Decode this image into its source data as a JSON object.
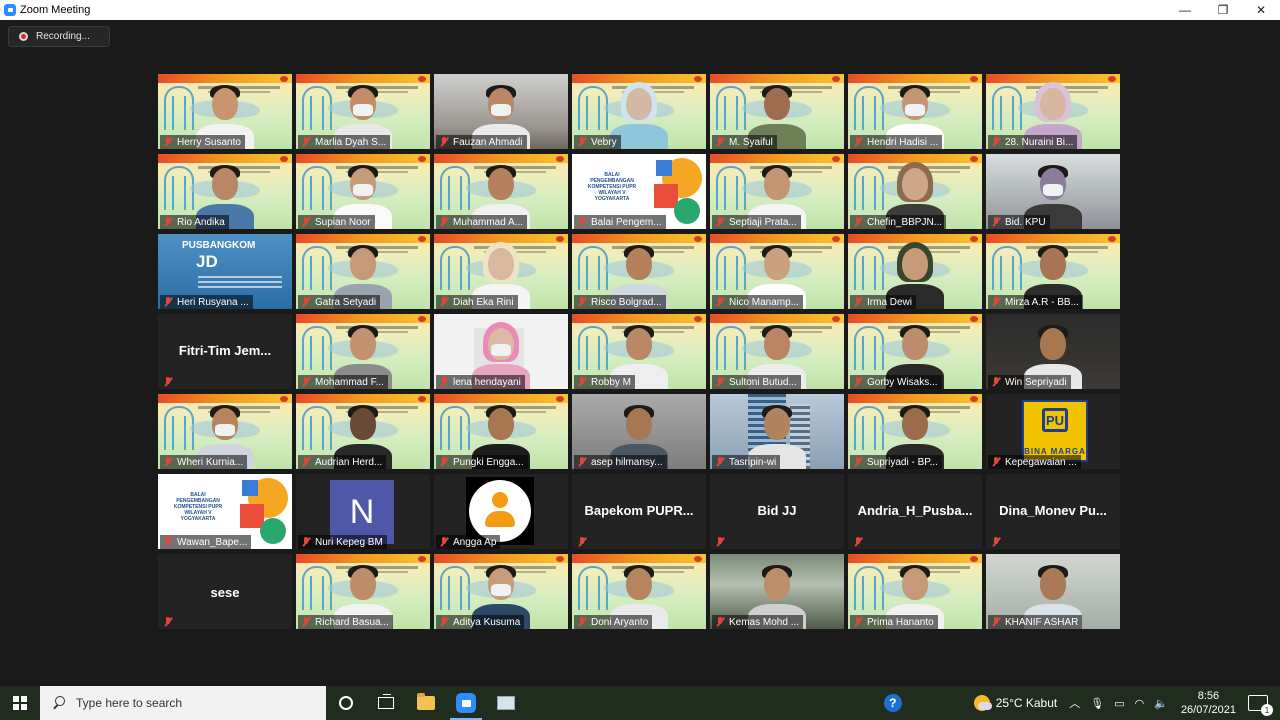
{
  "window": {
    "title": "Zoom Meeting",
    "minimize": "—",
    "restore": "❐",
    "close": "✕"
  },
  "recording": {
    "label": "Recording..."
  },
  "participants": [
    {
      "name": "Herry Susanto"
    },
    {
      "name": "Marlia Dyah S..."
    },
    {
      "name": "Fauzan Ahmadi"
    },
    {
      "name": "Vebry"
    },
    {
      "name": "M. Syaiful"
    },
    {
      "name": "Hendri Hadisi ..."
    },
    {
      "name": "28. Nuraini Bi..."
    },
    {
      "name": "Rio Andika"
    },
    {
      "name": "Supian Noor"
    },
    {
      "name": "Muhammad A..."
    },
    {
      "name": "Balai Pengem..."
    },
    {
      "name": "Septiaji Prata..."
    },
    {
      "name": "Chefin_BBPJN..."
    },
    {
      "name": "Bid. KPU"
    },
    {
      "name": "Heri Rusyana ..."
    },
    {
      "name": "Gatra Setyadi"
    },
    {
      "name": "Diah Eka Rini"
    },
    {
      "name": "Risco Bolgrad..."
    },
    {
      "name": "Nico Manamp..."
    },
    {
      "name": "Irma Dewi"
    },
    {
      "name": "Mirza A.R - BB..."
    },
    {
      "name": "Fitri-Tim Jem..."
    },
    {
      "name": "Mohammad F..."
    },
    {
      "name": "lena hendayani"
    },
    {
      "name": "Robby M"
    },
    {
      "name": "Sultoni Butud..."
    },
    {
      "name": "Gorby Wisaks..."
    },
    {
      "name": "Win Sepriyadi"
    },
    {
      "name": "Wheri Kurnia..."
    },
    {
      "name": "Audrian Herd..."
    },
    {
      "name": "Pungki Engga..."
    },
    {
      "name": "asep hilmansy..."
    },
    {
      "name": "Tasripin-wi"
    },
    {
      "name": "Supriyadi - BP..."
    },
    {
      "name": "Kepegawaian ..."
    },
    {
      "name": "Wawan_Bape..."
    },
    {
      "name": "Nuri Kepeg BM"
    },
    {
      "name": "Angga Ap"
    },
    {
      "name": "Bapekom PUPR..."
    },
    {
      "name": "Bid JJ"
    },
    {
      "name": "Andria_H_Pusba..."
    },
    {
      "name": "Dina_Monev Pu..."
    },
    {
      "name": "sese"
    },
    {
      "name": "Richard Basua..."
    },
    {
      "name": "Aditya Kusuma"
    },
    {
      "name": "Doni Aryanto"
    },
    {
      "name": "Kemas Mohd ..."
    },
    {
      "name": "Prima Hananto"
    },
    {
      "name": "KHANIF ASHAR"
    }
  ],
  "backgrounds": {
    "pusbangkom": {
      "heading": "PUSBANGKOM",
      "big": "JD"
    },
    "balai": {
      "text": "BALAI PENGEMBANGAN KOMPETENSI PUPR WILAYAH V YOGYAKARTA"
    },
    "avatar_letter": "N",
    "logo": {
      "pu": "PU",
      "caption": "BINA MARGA"
    }
  },
  "taskbar": {
    "search_placeholder": "Type here to search",
    "help": "?",
    "weather": "25°C  Kabut",
    "time": "8:56",
    "date": "26/07/2021",
    "notifications": "1"
  }
}
